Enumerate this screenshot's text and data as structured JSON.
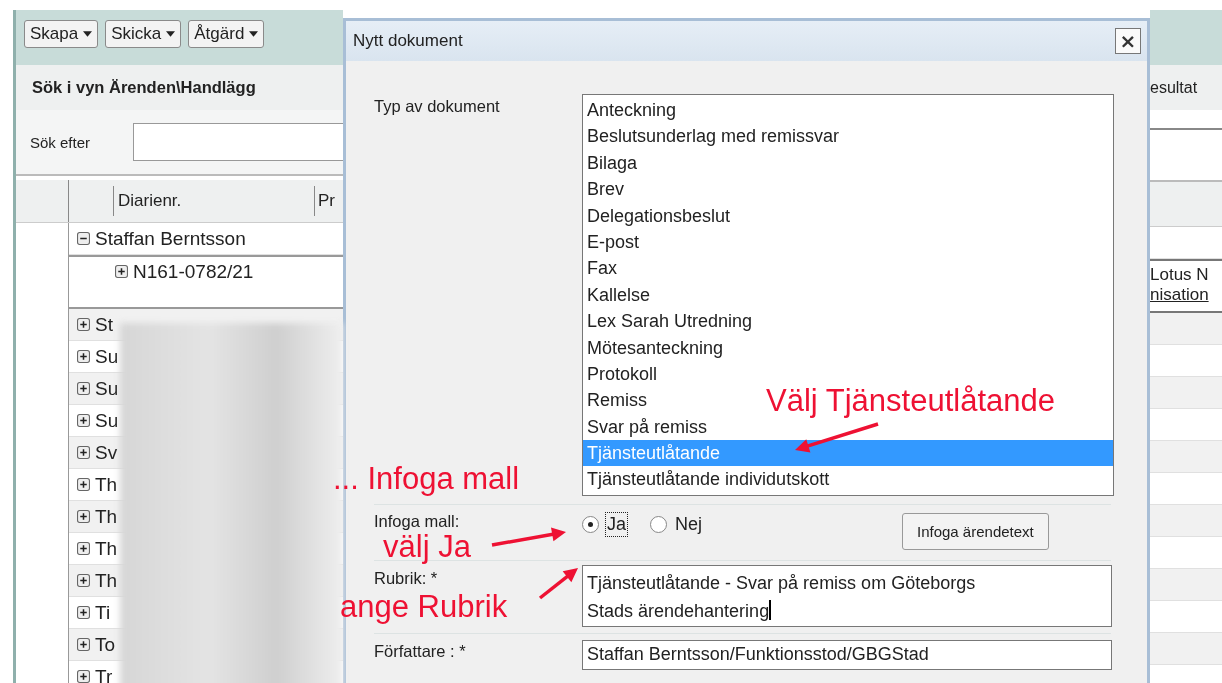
{
  "app": {
    "toolbar": [
      {
        "label": "Skapa"
      },
      {
        "label": "Skicka"
      },
      {
        "label": "Åtgärd"
      }
    ],
    "view_title": "Sök i vyn Ärenden\\Handlägg",
    "search": {
      "label": "Sök efter"
    },
    "columns": [
      "Diarienr.",
      "Pr"
    ],
    "tree": [
      {
        "label": "Staffan Berntsson",
        "expanded": true,
        "children": [
          {
            "label": "N161-0782/21",
            "expanded": false
          }
        ]
      },
      {
        "label": "St",
        "expanded": false
      },
      {
        "label": "Su",
        "expanded": false
      },
      {
        "label": "Su",
        "expanded": false
      },
      {
        "label": "Su",
        "expanded": false
      },
      {
        "label": "Sv",
        "expanded": false
      },
      {
        "label": "Th",
        "expanded": false
      },
      {
        "label": "Th",
        "expanded": false
      },
      {
        "label": "Th",
        "expanded": false
      },
      {
        "label": "Th",
        "expanded": false
      },
      {
        "label": "Ti",
        "expanded": false
      },
      {
        "label": "To",
        "expanded": false
      },
      {
        "label": "Tr",
        "expanded": false
      }
    ],
    "right_strip": {
      "header": "esultat",
      "cell_text": "Lotus N",
      "cell_link": "nisation"
    }
  },
  "dialog": {
    "title": "Nytt dokument",
    "close": "×",
    "type_label": "Typ av dokument",
    "types": [
      {
        "label": "Anteckning",
        "selected": false
      },
      {
        "label": "Beslutsunderlag med remissvar",
        "selected": false
      },
      {
        "label": "Bilaga",
        "selected": false
      },
      {
        "label": "Brev",
        "selected": false
      },
      {
        "label": "Delegationsbeslut",
        "selected": false
      },
      {
        "label": "E-post",
        "selected": false
      },
      {
        "label": "Fax",
        "selected": false
      },
      {
        "label": "Kallelse",
        "selected": false
      },
      {
        "label": "Lex Sarah Utredning",
        "selected": false
      },
      {
        "label": "Mötesanteckning",
        "selected": false
      },
      {
        "label": "Protokoll",
        "selected": false
      },
      {
        "label": "Remiss",
        "selected": false
      },
      {
        "label": "Svar på remiss",
        "selected": false
      },
      {
        "label": "Tjänsteutlåtande",
        "selected": true
      },
      {
        "label": "Tjänsteutlåtande individutskott",
        "selected": false
      }
    ],
    "template_label": "Infoga mall:",
    "template_options": [
      {
        "label": "Ja",
        "selected": true
      },
      {
        "label": "Nej",
        "selected": false
      }
    ],
    "insert_button": "Infoga ärendetext",
    "heading_label": "Rubrik: *",
    "heading_value": "Tjänsteutlåtande - Svar på remiss om Göteborgs Stads ärendehantering",
    "author_label": "Författare : *",
    "author_value": "Staffan Berntsson/Funktionsstod/GBGStad"
  },
  "annotations": [
    {
      "text": "Välj Tjänsteutlåtande",
      "arrow": true
    },
    {
      "text": "... Infoga mall",
      "arrow": false
    },
    {
      "text": "välj Ja",
      "arrow": true
    },
    {
      "text": "ange Rubrik",
      "arrow": true
    }
  ]
}
